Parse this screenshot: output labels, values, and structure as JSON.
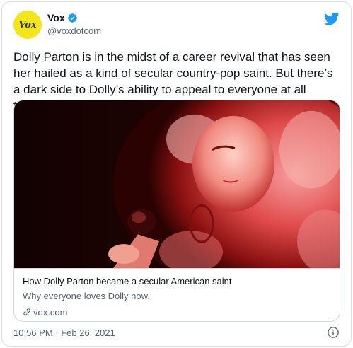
{
  "author": {
    "display_name": "Vox",
    "handle": "@voxdotcom",
    "avatar_text": "Vox",
    "verified": true
  },
  "tweet": {
    "text": "Dolly Parton is in the midst of a career revival that has seen her hailed as a kind of secular country-pop saint. But there’s a dark side to Dolly’s ability to appeal to everyone at all times:",
    "timestamp": "10:56 PM · Feb 26, 2021"
  },
  "card": {
    "title": "How Dolly Parton became a secular American saint",
    "description": "Why everyone loves Dolly now.",
    "domain": "vox.com"
  },
  "icons": {
    "verified": "verified-badge-icon",
    "brand": "twitter-bird-icon",
    "link": "link-icon",
    "info": "info-icon"
  },
  "colors": {
    "brand_blue": "#1d9bf0",
    "avatar_yellow": "#f2e51a",
    "text_primary": "#0f1419",
    "text_secondary": "#536471"
  }
}
